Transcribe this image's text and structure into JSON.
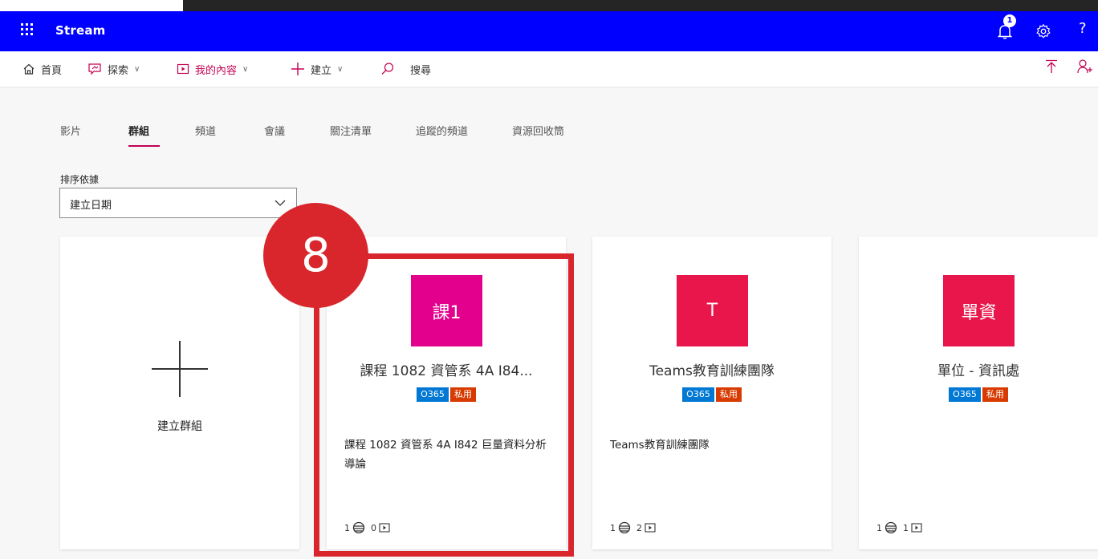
{
  "app": {
    "name": "Stream",
    "notification_count": "1",
    "help_label": "?",
    "brand_color": "#0000ff",
    "accent_color": "#c30052"
  },
  "commands": {
    "home": "首頁",
    "discover": "探索",
    "my_content": "我的內容",
    "create": "建立",
    "search": "搜尋"
  },
  "tabs": [
    {
      "label": "影片",
      "active": false
    },
    {
      "label": "群組",
      "active": true
    },
    {
      "label": "頻道",
      "active": false
    },
    {
      "label": "會議",
      "active": false
    },
    {
      "label": "關注清單",
      "active": false
    },
    {
      "label": "追蹤的頻道",
      "active": false
    },
    {
      "label": "資源回收筒",
      "active": false
    }
  ],
  "sort": {
    "label": "排序依據",
    "value": "建立日期"
  },
  "create_card": {
    "label": "建立群組"
  },
  "groups": [
    {
      "avatar_text": "課1",
      "avatar_color": "#e3008c",
      "title": "課程 1082 資管系 4A I84...",
      "badges": [
        "O365",
        "私用"
      ],
      "description": "課程 1082 資管系 4A I842 巨量資料分析導論",
      "members": "1",
      "videos": "0"
    },
    {
      "avatar_text": "T",
      "avatar_color": "#e8164a",
      "title": "Teams教育訓練團隊",
      "badges": [
        "O365",
        "私用"
      ],
      "description": "Teams教育訓練團隊",
      "members": "1",
      "videos": "2"
    },
    {
      "avatar_text": "單資",
      "avatar_color": "#e8164a",
      "title": "單位 - 資訊處",
      "badges": [
        "O365",
        "私用"
      ],
      "description": "",
      "members": "1",
      "videos": "1"
    }
  ],
  "annotation": {
    "step_number": "8",
    "color": "#d9262c"
  }
}
